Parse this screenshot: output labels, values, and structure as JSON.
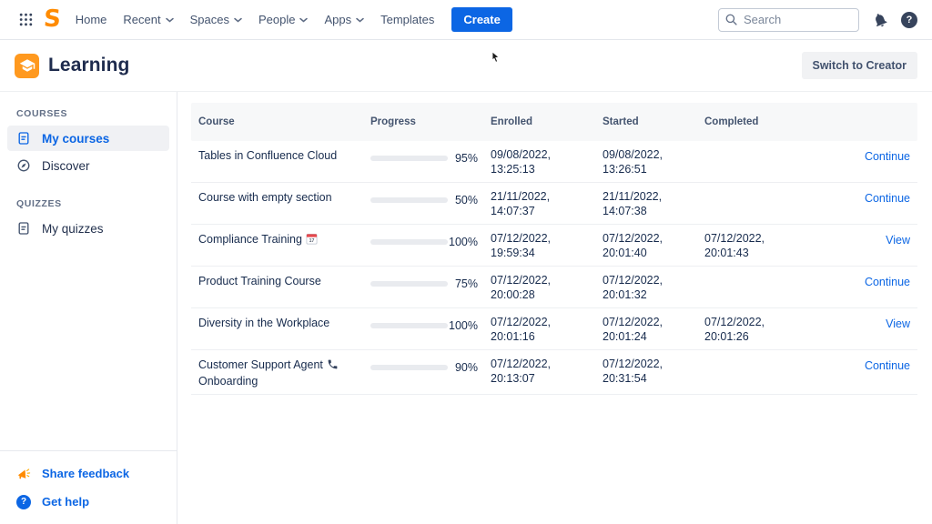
{
  "topnav": {
    "logo_letter": "S",
    "nav_items": [
      {
        "label": "Home",
        "has_dropdown": false
      },
      {
        "label": "Recent",
        "has_dropdown": true
      },
      {
        "label": "Spaces",
        "has_dropdown": true
      },
      {
        "label": "People",
        "has_dropdown": true
      },
      {
        "label": "Apps",
        "has_dropdown": true
      },
      {
        "label": "Templates",
        "has_dropdown": false
      }
    ],
    "create_label": "Create",
    "search_placeholder": "Search",
    "help_glyph": "?"
  },
  "header": {
    "app_title": "Learning",
    "switch_button_label": "Switch to Creator"
  },
  "sidebar": {
    "sections": [
      {
        "label": "COURSES",
        "items": [
          {
            "label": "My courses",
            "icon": "document-icon",
            "active": true
          },
          {
            "label": "Discover",
            "icon": "compass-icon",
            "active": false
          }
        ]
      },
      {
        "label": "QUIZZES",
        "items": [
          {
            "label": "My quizzes",
            "icon": "document-icon",
            "active": false
          }
        ]
      }
    ],
    "footer_items": [
      {
        "label": "Share feedback",
        "icon": "megaphone-icon"
      },
      {
        "label": "Get help",
        "icon": "help-circle-icon",
        "glyph": "?"
      }
    ]
  },
  "table": {
    "columns": [
      "Course",
      "Progress",
      "Enrolled",
      "Started",
      "Completed"
    ],
    "rows": [
      {
        "course": "Tables in Confluence Cloud",
        "icon": "",
        "course_line2": "",
        "progress": 95,
        "percent": "95%",
        "enrolled_date": "09/08/2022,",
        "enrolled_time": "13:25:13",
        "started_date": "09/08/2022,",
        "started_time": "13:26:51",
        "completed_date": "",
        "completed_time": "",
        "action": "Continue"
      },
      {
        "course": "Course with empty section",
        "icon": "",
        "course_line2": "",
        "progress": 50,
        "percent": "50%",
        "enrolled_date": "21/11/2022,",
        "enrolled_time": "14:07:37",
        "started_date": "21/11/2022,",
        "started_time": "14:07:38",
        "completed_date": "",
        "completed_time": "",
        "action": "Continue"
      },
      {
        "course": "Compliance Training",
        "icon": "calendar",
        "course_line2": "",
        "progress": 100,
        "percent": "100%",
        "enrolled_date": "07/12/2022,",
        "enrolled_time": "19:59:34",
        "started_date": "07/12/2022,",
        "started_time": "20:01:40",
        "completed_date": "07/12/2022,",
        "completed_time": "20:01:43",
        "action": "View"
      },
      {
        "course": "Product Training Course",
        "icon": "",
        "course_line2": "",
        "progress": 75,
        "percent": "75%",
        "enrolled_date": "07/12/2022,",
        "enrolled_time": "20:00:28",
        "started_date": "07/12/2022,",
        "started_time": "20:01:32",
        "completed_date": "",
        "completed_time": "",
        "action": "Continue"
      },
      {
        "course": "Diversity in the Workplace",
        "icon": "",
        "course_line2": "",
        "progress": 100,
        "percent": "100%",
        "enrolled_date": "07/12/2022,",
        "enrolled_time": "20:01:16",
        "started_date": "07/12/2022,",
        "started_time": "20:01:24",
        "completed_date": "07/12/2022,",
        "completed_time": "20:01:26",
        "action": "View"
      },
      {
        "course": "Customer Support Agent",
        "icon": "phone",
        "course_line2": "Onboarding",
        "progress": 90,
        "percent": "90%",
        "enrolled_date": "07/12/2022,",
        "enrolled_time": "20:13:07",
        "started_date": "07/12/2022,",
        "started_time": "20:31:54",
        "completed_date": "",
        "completed_time": "",
        "action": "Continue"
      }
    ],
    "calendar_emoji_day": "17"
  },
  "colors": {
    "accent_blue": "#0C66E4",
    "progress_blue": "#1D7AFC",
    "brand_orange": "#FF8B00",
    "app_tile_orange": "#FF991F",
    "text_primary": "#172B4D",
    "text_secondary": "#44546F"
  }
}
